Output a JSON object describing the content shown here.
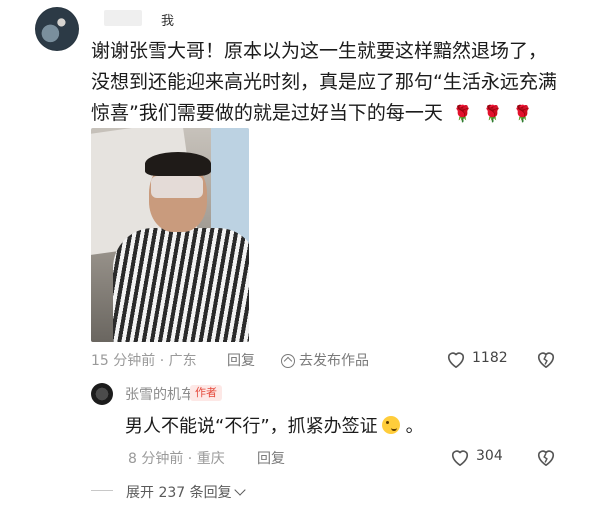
{
  "comment": {
    "self_tag": "我",
    "lines": [
      "谢谢张雪大哥！原本以为这一生就要这样黯然退场了，",
      "没想到还能迎来高光时刻，真是应了那句“生活永远充满",
      "惊喜”我们需要做的就是过好当下的每一天"
    ],
    "flowers": [
      "🌹",
      "🌹",
      "🌹"
    ],
    "meta": "15 分钟前 · 广东",
    "reply_label": "回复",
    "goto_label": "去发布作品",
    "like_count": "1182"
  },
  "reply": {
    "username": "张雪的机车",
    "author_tag": "作者",
    "text": "男人不能说“不行”，抓紧办签证",
    "after_emoji": "。",
    "meta": "8 分钟前 · 重庆",
    "reply_label": "回复",
    "like_count": "304"
  },
  "expand": {
    "label": "展开 237 条回复"
  },
  "colors": {
    "accent_red": "#e5493b",
    "meta_gray": "#9a9a9a"
  },
  "icons": {
    "like": "heart-outline-icon",
    "dislike": "broken-heart-icon",
    "goto": "arrow-circle-icon",
    "expand": "chevron-down-icon"
  }
}
